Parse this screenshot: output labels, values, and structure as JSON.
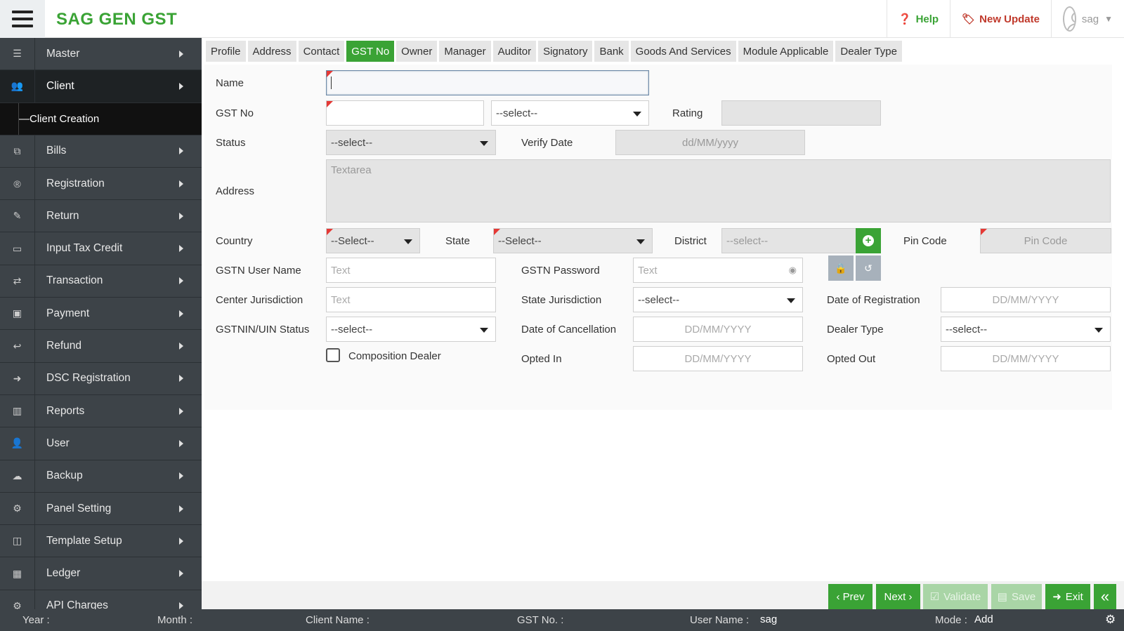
{
  "header": {
    "brand": "SAG GEN GST",
    "help_label": "Help",
    "update_label": "New Update",
    "user_name": "sag"
  },
  "sidebar": {
    "items": [
      {
        "label": "Master",
        "icon": "database-icon"
      },
      {
        "label": "Client",
        "icon": "users-icon"
      },
      {
        "label": "Bills",
        "icon": "copy-icon"
      },
      {
        "label": "Registration",
        "icon": "registered-icon"
      },
      {
        "label": "Return",
        "icon": "edit-icon"
      },
      {
        "label": "Input Tax Credit",
        "icon": "credit-card-icon"
      },
      {
        "label": "Transaction",
        "icon": "exchange-icon"
      },
      {
        "label": "Payment",
        "icon": "money-icon"
      },
      {
        "label": "Refund",
        "icon": "reply-icon"
      },
      {
        "label": "DSC Registration",
        "icon": "sign-in-icon"
      },
      {
        "label": "Reports",
        "icon": "bar-chart-icon"
      },
      {
        "label": "User",
        "icon": "user-plus-icon"
      },
      {
        "label": "Backup",
        "icon": "cloud-download-icon"
      },
      {
        "label": "Panel Setting",
        "icon": "cogs-icon"
      },
      {
        "label": "Template Setup",
        "icon": "columns-icon"
      },
      {
        "label": "Ledger",
        "icon": "calculator-icon"
      },
      {
        "label": "API Charges",
        "icon": "cog-icon"
      }
    ],
    "sub_item": "Client Creation"
  },
  "tabs": [
    "Profile",
    "Address",
    "Contact",
    "GST No",
    "Owner",
    "Manager",
    "Auditor",
    "Signatory",
    "Bank",
    "Goods And Services",
    "Module Applicable",
    "Dealer Type"
  ],
  "form": {
    "name_label": "Name",
    "gstno_label": "GST No",
    "gstno_select": "--select--",
    "rating_label": "Rating",
    "status_label": "Status",
    "status_select": "--select--",
    "verify_label": "Verify Date",
    "verify_placeholder": "dd/MM/yyyy",
    "address_label": "Address",
    "address_placeholder": "Textarea",
    "country_label": "Country",
    "country_select": "--Select--",
    "state_label": "State",
    "state_select": "--Select--",
    "district_label": "District",
    "district_select": "--select--",
    "pincode_label": "Pin Code",
    "pincode_placeholder": "Pin Code",
    "gstn_user_label": "GSTN User Name",
    "text_placeholder": "Text",
    "gstn_pass_label": "GSTN Password",
    "center_label": "Center Jurisdiction",
    "state_jur_label": "State Jurisdiction",
    "state_jur_select": "--select--",
    "dor_label": "Date of Registration",
    "date_placeholder": "DD/MM/YYYY",
    "uin_label": "GSTNIN/UIN Status",
    "uin_select": "--select--",
    "doc_label": "Date of Cancellation",
    "dealer_label": "Dealer Type",
    "dealer_select": "--select--",
    "composition_label": "Composition Dealer",
    "opted_in_label": "Opted In",
    "opted_out_label": "Opted Out"
  },
  "actions": {
    "prev": "‹ Prev",
    "next": "Next ›",
    "validate": "Validate",
    "save": "Save",
    "exit": "Exit"
  },
  "footer": {
    "year_label": "Year :",
    "month_label": "Month :",
    "client_label": "Client Name :",
    "gst_label": "GST No. :",
    "user_label": "User Name :",
    "user_value": "sag",
    "mode_label": "Mode :",
    "mode_value": "Add"
  },
  "colors": {
    "accent": "#3aa335",
    "sidebar": "#3d4348",
    "update": "#c0392b"
  }
}
